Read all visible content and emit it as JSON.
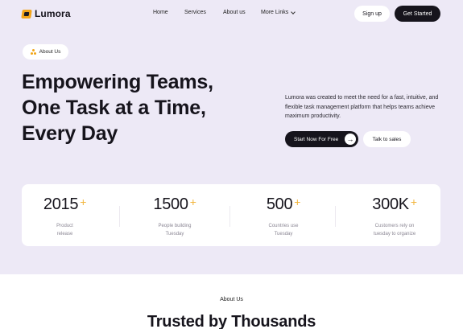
{
  "brand": {
    "name": "Lumora"
  },
  "nav": {
    "items": [
      "Home",
      "Services",
      "About us",
      "More Links"
    ]
  },
  "header": {
    "signup_label": "Sign up",
    "get_started_label": "Get Started"
  },
  "hero": {
    "badge": "About Us",
    "headline": [
      "Empowering Teams,",
      "One Task at a Time,",
      "Every Day"
    ],
    "description": "Lumora was created to meet the need for a fast, intuitive, and flexible task management platform that helps teams achieve maximum productivity.",
    "primary_cta": "Start Now For Free",
    "secondary_cta": "Talk to sales"
  },
  "stats": [
    {
      "value": "2015",
      "plus": "+",
      "label": "Product release"
    },
    {
      "value": "1500",
      "plus": "+",
      "label": "People building Tuesday"
    },
    {
      "value": "500",
      "plus": "+",
      "label": "Countries use Tuesday"
    },
    {
      "value": "300K",
      "plus": "+",
      "label": "Customers rely on tuesday to organize"
    }
  ],
  "about_section": {
    "label": "About Us",
    "title": "Trusted by Thousands"
  },
  "colors": {
    "accent": "#f2a51a",
    "dark": "#16141c",
    "hero_bg": "#ede9f6"
  },
  "icons": {
    "nav_dropdown": "chevron-down-icon",
    "cta_arrow": "arrow-right-icon",
    "badge": "cluster-icon"
  }
}
